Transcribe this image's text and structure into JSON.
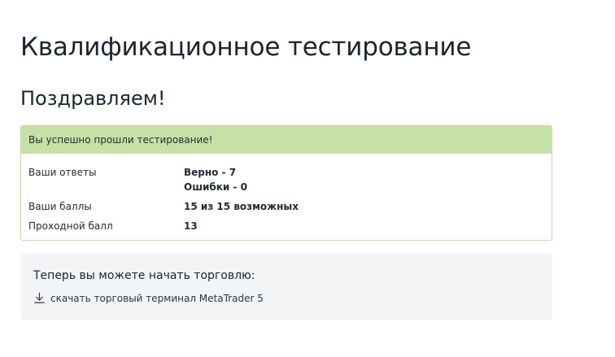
{
  "page": {
    "title": "Квалификационное тестирование",
    "congrats": "Поздравляем!"
  },
  "result": {
    "header": "Вы успешно прошли тестирование!",
    "answers_label": "Ваши ответы",
    "correct": "Верно - 7",
    "errors": "Ошибки - 0",
    "score_label": "Ваши баллы",
    "score_value": "15 из 15 возможных",
    "passing_label": "Проходной балл",
    "passing_value": "13"
  },
  "trade": {
    "title": "Теперь вы можете начать торговлю:",
    "download_label": "скачать торговый терминал MetaTrader 5",
    "download_icon": "download-icon"
  },
  "colors": {
    "success_header_bg": "#c5e1a5",
    "success_border": "#c1dea6",
    "info_box_bg": "#f3f4f6"
  }
}
